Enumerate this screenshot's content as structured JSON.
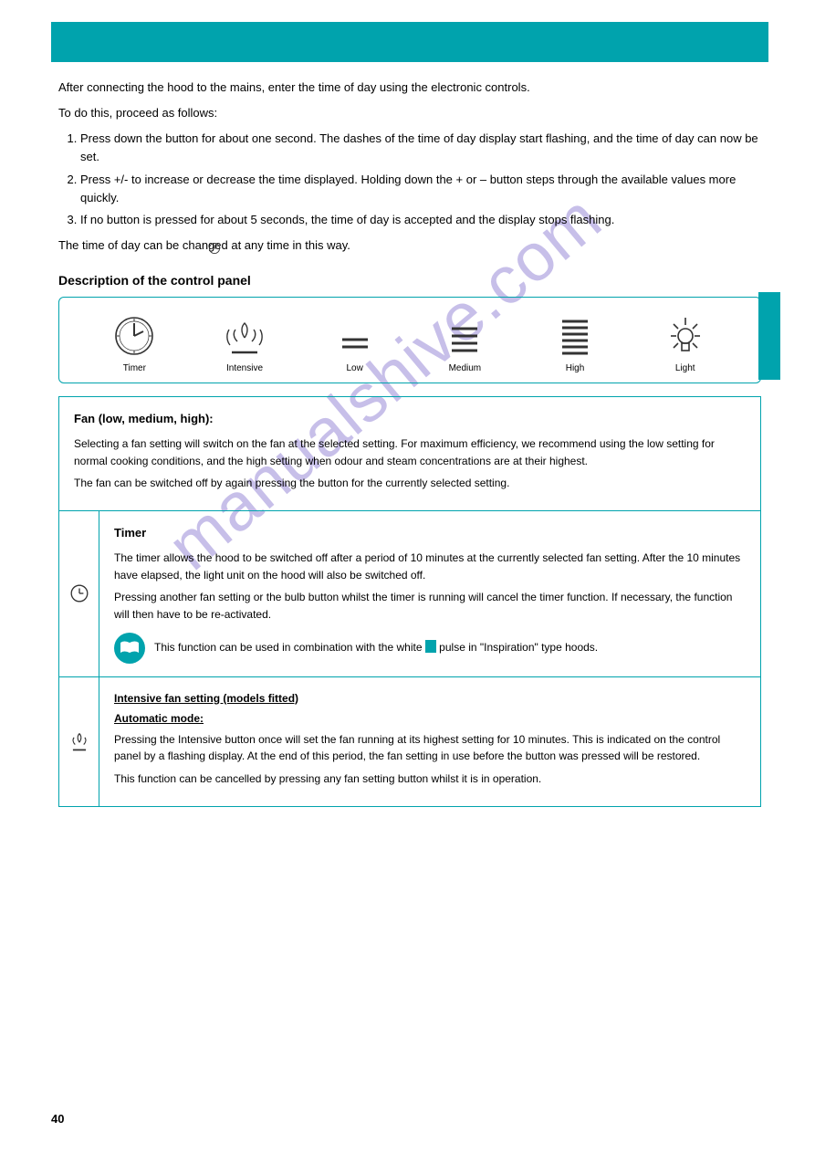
{
  "page_number": "40",
  "watermark": "manualshive.com",
  "intro": {
    "paras": [
      "After connecting the hood to the mains, enter the time of day using the electronic controls.",
      "To do this, proceed as follows:"
    ],
    "steps": [
      "Press down the         button for about one second. The dashes of the time of day display start flashing, and the time of day can now be set.",
      "Press +/- to increase or decrease the time displayed. Holding down the + or – button steps through the available values more quickly.",
      "If no button is pressed for about 5 seconds, the time of day is accepted and the display stops flashing."
    ],
    "note": "The time of day can be changed at any time in this way."
  },
  "subheading": "Description of the control panel",
  "panel_icons": [
    "Timer",
    "Intensive",
    "Low",
    "Medium",
    "High",
    "Light"
  ],
  "rows": [
    {
      "type": "full",
      "heading": "Fan (low, medium, high):",
      "body": [
        "Selecting a fan setting will switch on the fan at the selected setting. For maximum efficiency, we recommend using the low setting for normal cooking conditions, and the high setting when odour and steam concentrations are at their highest.",
        "The fan can be switched off by again pressing the button for the currently selected setting."
      ]
    },
    {
      "type": "split",
      "icon": "clock",
      "heading": "Timer",
      "body": [
        "The timer allows the hood to be switched off after a period of 10 minutes at the currently selected fan setting. After the 10 minutes have elapsed, the light unit on the hood will also be switched off.",
        "Pressing another fan setting or the bulb button whilst the timer is running will cancel the timer function. If necessary, the function will then have to be re-activated."
      ],
      "note_text": "This function can be used in combination with the white       pulse in \"Inspiration\" type hoods."
    },
    {
      "type": "split",
      "icon": "intensive",
      "heading": "Intensive fan setting (models fitted)",
      "sub": "Automatic mode:",
      "body": [
        "Pressing the Intensive button once will set the fan running at its highest setting for 10 minutes. This is indicated on the control panel by a flashing display. At the end of this period, the fan setting in use before the button was pressed will be restored.",
        "This function can be cancelled by pressing any fan setting button whilst it is in operation."
      ]
    }
  ]
}
